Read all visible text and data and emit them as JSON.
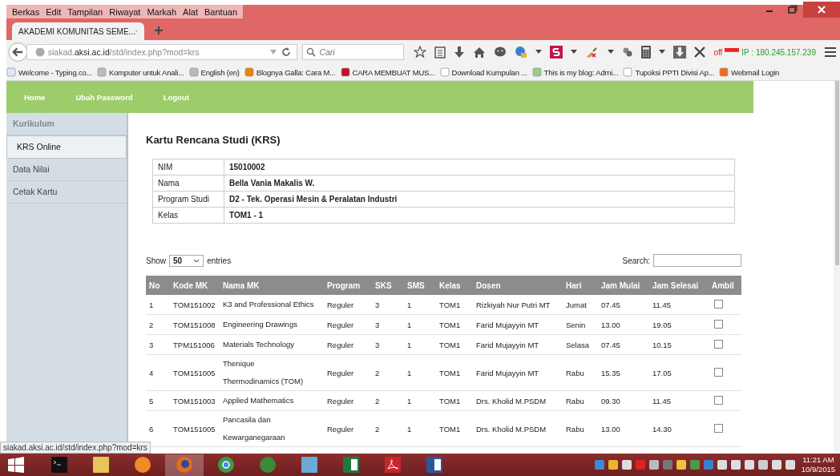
{
  "menu_bar": [
    "Berkas",
    "Edit",
    "Tampilan",
    "Riwayat",
    "Markah",
    "Alat",
    "Bantuan"
  ],
  "tab": {
    "title": "AKADEMI KOMUNITAS SEME...",
    "selected": true
  },
  "address_bar": {
    "url_prefix": "siakad.",
    "url_domain": "aksi.ac.id",
    "url_path": "/std/index.php?mod=krs"
  },
  "search": {
    "placeholder": "Cari"
  },
  "addon": {
    "status": "off",
    "ip": "IP : 180.245.157.239"
  },
  "bookmarks": [
    {
      "label": "Welcome - Typing.co..."
    },
    {
      "label": "Komputer untuk Anali..."
    },
    {
      "label": "English (en)"
    },
    {
      "label": "Blognya Galla: Cara M..."
    },
    {
      "label": "CARA MEMBUAT MUS..."
    },
    {
      "label": "Download Kumpulan ..."
    },
    {
      "label": "This is my blog: Admi..."
    },
    {
      "label": "Tupoksi PPTI Divisi Ap..."
    },
    {
      "label": "Webmail Login"
    }
  ],
  "site_nav": [
    "Home",
    "Ubah Password",
    "Logout"
  ],
  "sidebar": [
    {
      "label": "Kurikulum",
      "kind": "header",
      "selected": false
    },
    {
      "label": "KRS Online",
      "kind": "item",
      "selected": true
    },
    {
      "label": "Data Nilai",
      "kind": "item",
      "selected": false
    },
    {
      "label": "Cetak Kartu",
      "kind": "item",
      "selected": false
    }
  ],
  "heading": "Kartu Rencana Studi (KRS)",
  "student_info": [
    {
      "label": "NIM",
      "value": "15010002"
    },
    {
      "label": "Nama",
      "value": "Bella Vania Makalis W."
    },
    {
      "label": "Program Studi",
      "value": "D2 - Tek. Operasi Mesin & Peralatan Industri"
    },
    {
      "label": "Kelas",
      "value": "TOM1 - 1"
    }
  ],
  "length_menu": {
    "before": "Show",
    "value": "50",
    "after": "entries"
  },
  "search_box": {
    "label": "Search:"
  },
  "table": {
    "columns": [
      "No",
      "Kode MK",
      "Nama MK",
      "Program",
      "SKS",
      "SMS",
      "Kelas",
      "Dosen",
      "Hari",
      "Jam Mulai",
      "Jam Selesai",
      "Ambil"
    ],
    "rows": [
      {
        "no": "1",
        "kode": "TOM151002",
        "nama": [
          "K3 and Professional Ethics"
        ],
        "program": "Reguler",
        "sks": "3",
        "sms": "1",
        "kelas": "TOM1",
        "dosen": "Rizkiyah Nur Putri MT",
        "hari": "Jumat",
        "mulai": "07.45",
        "selesai": "11.45",
        "ambil": false
      },
      {
        "no": "2",
        "kode": "TOM151008",
        "nama": [
          "Engineering Drawings"
        ],
        "program": "Reguler",
        "sks": "3",
        "sms": "1",
        "kelas": "TOM1",
        "dosen": "Farid Mujayyin MT",
        "hari": "Senin",
        "mulai": "13.00",
        "selesai": "19.05",
        "ambil": false
      },
      {
        "no": "3",
        "kode": "TPM151006",
        "nama": [
          "Materials Technology"
        ],
        "program": "Reguler",
        "sks": "3",
        "sms": "1",
        "kelas": "TOM1",
        "dosen": "Farid Mujayyin MT",
        "hari": "Selasa",
        "mulai": "07.45",
        "selesai": "10.15",
        "ambil": false
      },
      {
        "no": "4",
        "kode": "TOM151005",
        "nama": [
          "Thenique",
          "Thermodinamics (TOM)"
        ],
        "program": "Reguler",
        "sks": "2",
        "sms": "1",
        "kelas": "TOM1",
        "dosen": "Farid Mujayyin MT",
        "hari": "Rabu",
        "mulai": "15.35",
        "selesai": "17.05",
        "ambil": false
      },
      {
        "no": "5",
        "kode": "TOM151003",
        "nama": [
          "Applied Mathematics"
        ],
        "program": "Reguler",
        "sks": "2",
        "sms": "1",
        "kelas": "TOM1",
        "dosen": "Drs. Kholid M.PSDM",
        "hari": "Rabu",
        "mulai": "09.30",
        "selesai": "11.45",
        "ambil": false
      },
      {
        "no": "6",
        "kode": "TOM151005",
        "nama": [
          "Pancasila dan",
          "Kewarganegaraan"
        ],
        "program": "Reguler",
        "sks": "2",
        "sms": "1",
        "kelas": "TOM1",
        "dosen": "Drs. Kholid M.PSDM",
        "hari": "Rabu",
        "mulai": "13.00",
        "selesai": "14.30",
        "ambil": false
      }
    ]
  },
  "status_url": "siakad.aksi.ac.id/std/index.php?mod=krs",
  "taskbar": {
    "apps": [
      {
        "kind": "cmd",
        "selected": false
      },
      {
        "kind": "folder",
        "selected": false
      },
      {
        "kind": "uc",
        "selected": false
      },
      {
        "kind": "firefox",
        "selected": true
      },
      {
        "kind": "chrome",
        "selected": false
      },
      {
        "kind": "idm",
        "selected": false
      },
      {
        "kind": "notepad",
        "selected": false
      },
      {
        "kind": "excel",
        "selected": false
      },
      {
        "kind": "acrobat",
        "selected": false
      },
      {
        "kind": "word",
        "selected": false
      }
    ],
    "time": "11:21 AM",
    "date": "10/9/2015"
  }
}
